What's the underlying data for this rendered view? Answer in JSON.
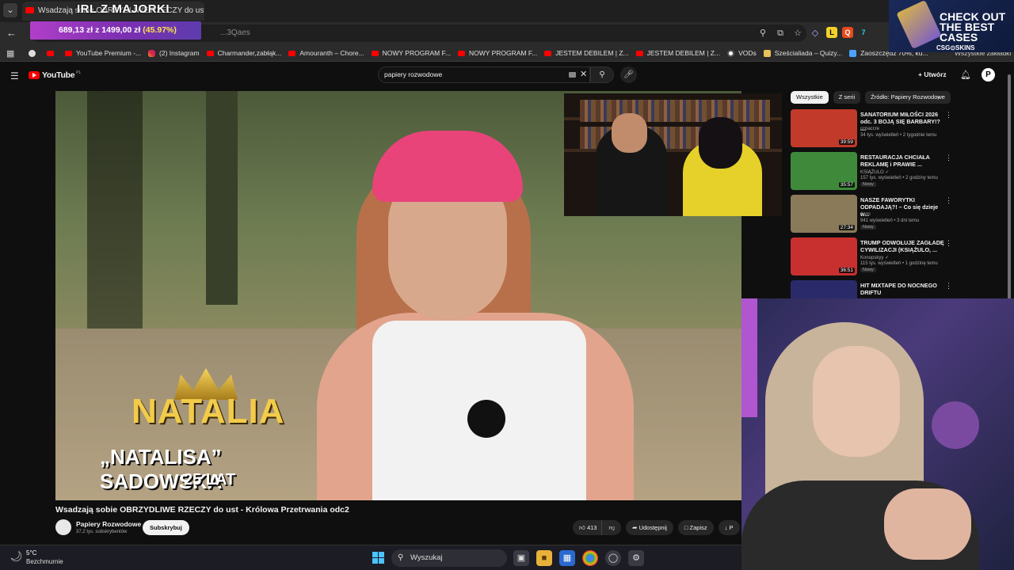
{
  "browser": {
    "tab_title": "Wsadzają sobie OBRZYDLIWE RZECZY do ust",
    "url_fragment": "...3Qaes",
    "menu_glyph": "⌄",
    "back_glyph": "←",
    "toolbar_icons": [
      "zoom-icon",
      "cast-icon",
      "star-icon"
    ],
    "right_bookmark": "Wszystkie zakładki"
  },
  "stream_overlay": {
    "title": "IRL Z MAJORKI",
    "donation_current": "689,13 zł",
    "donation_sep": "z",
    "donation_goal": "1499,00 zł",
    "donation_pct": "(45.97%)"
  },
  "bookmarks": [
    {
      "label": "",
      "icon": "gh"
    },
    {
      "label": "",
      "icon": "yt"
    },
    {
      "label": "YouTube Premium -...",
      "icon": "yt"
    },
    {
      "label": "(2) Instagram",
      "icon": "ig"
    },
    {
      "label": "Charmander,zabłąk...",
      "icon": "yt"
    },
    {
      "label": "Amouranth – Chore...",
      "icon": "yt"
    },
    {
      "label": "NOWY PROGRAM F...",
      "icon": "yt"
    },
    {
      "label": "NOWY PROGRAM F...",
      "icon": "yt"
    },
    {
      "label": "JESTEM DEBILEM | Z...",
      "icon": "yt"
    },
    {
      "label": "JESTEM DEBILEM | Z...",
      "icon": "yt"
    },
    {
      "label": "VODs",
      "icon": "gc"
    },
    {
      "label": "Sześcialiada – Quizy...",
      "icon": "ye"
    },
    {
      "label": "Zaoszczędź 70%, ku...",
      "icon": "bl"
    }
  ],
  "ad": {
    "line1": "CHECK OUT",
    "line2": "THE BEST",
    "line3": "CASES",
    "brand": "CSG⊙SKINS"
  },
  "youtube": {
    "logo": "YouTube",
    "logo_country": "PL",
    "search_value": "papiery rozwodowe",
    "create_label": "Utwórz",
    "avatar_letter": "P"
  },
  "video": {
    "name_line1": "NATALIA",
    "name_line2": "„NATALISA” SADOWSKA",
    "name_line3": "25 LAT",
    "title": "Wsadzają sobie OBRZYDLIWE RZECZY do ust - Królowa Przetrwania odc2",
    "channel": "Papiery Rozwodowe",
    "subscribers": "37,2 tys. subskrybentów",
    "subscribe_label": "Subskrybuj",
    "likes": "413",
    "share_label": "Udostępnij",
    "save_label": "Zapisz",
    "more_label": "P"
  },
  "chips": [
    "Wszystkie",
    "Z serii",
    "Źródło: Papiery Rozwodowe"
  ],
  "recommendations": [
    {
      "title": "SANATORIUM MIŁOŚCI 2026 odc. 3 BOJĄ SIĘ BARBARY!? ...",
      "channel": "ccpaccre",
      "meta": "34 tys. wyświetleń • 2 tygodnie temu",
      "badge": "",
      "duration": "39:59",
      "color": "#c23a2a"
    },
    {
      "title": "RESTAURACJA CHCIAŁA REKLAMĘ i PRAWIE ...",
      "channel": "KSIĄŻULO ✓",
      "meta": "157 tys. wyświetleń • 2 godziny temu",
      "badge": "Nowy",
      "duration": "35:57",
      "color": "#3f8a3a"
    },
    {
      "title": "NASZE FAWORYTKI ODPADAJĄ?! – Co się dzieje w...",
      "channel": "Aron",
      "meta": "941 wyświetleń • 3 dni temu",
      "badge": "Nowy",
      "duration": "27:34",
      "color": "#8a7a5a"
    },
    {
      "title": "TRUMP ODWOŁUJE ZAGŁADĘ CYWILIZACJI (KSIĄŻULO, ...",
      "channel": "Konopskyy ✓",
      "meta": "115 tys. wyświetleń • 1 godzinę temu",
      "badge": "Nowy",
      "duration": "36:51",
      "color": "#c83030"
    },
    {
      "title": "HIT MIXTAPE DO NOCNEGO DRIFTU",
      "channel": "",
      "meta": "",
      "badge": "",
      "duration": "",
      "color": "#2a2a6a"
    }
  ],
  "taskbar": {
    "temp": "5°C",
    "condition": "Bezchmurnie",
    "search_placeholder": "Wyszukaj"
  }
}
